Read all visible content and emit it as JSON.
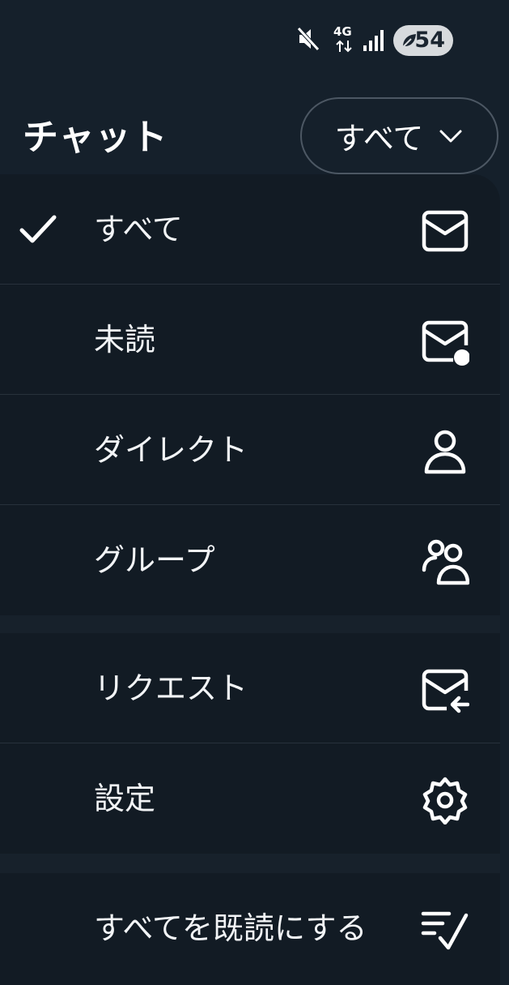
{
  "status_bar": {
    "network_label": "4G",
    "battery_level": "54",
    "icons": [
      "mute-icon",
      "4g-data-icon",
      "signal-icon",
      "battery-saver-icon"
    ]
  },
  "header": {
    "title": "チャット",
    "filter_label": "すべて",
    "filter_icon": "chevron-down-icon"
  },
  "menu": {
    "items": [
      {
        "label": "すべて",
        "icon": "mail-icon",
        "selected": true
      },
      {
        "label": "未読",
        "icon": "unread-mail-icon"
      },
      {
        "label": "ダイレクト",
        "icon": "person-icon"
      },
      {
        "label": "グループ",
        "icon": "people-icon"
      },
      {
        "label": "リクエスト",
        "icon": "mail-request-icon"
      },
      {
        "label": "設定",
        "icon": "gear-icon"
      },
      {
        "label": "すべてを既読にする",
        "icon": "mark-read-icon"
      }
    ]
  },
  "colors": {
    "background": "#15202b",
    "menu_background": "#121b24",
    "divider": "#27313b",
    "text": "#ffffff"
  }
}
